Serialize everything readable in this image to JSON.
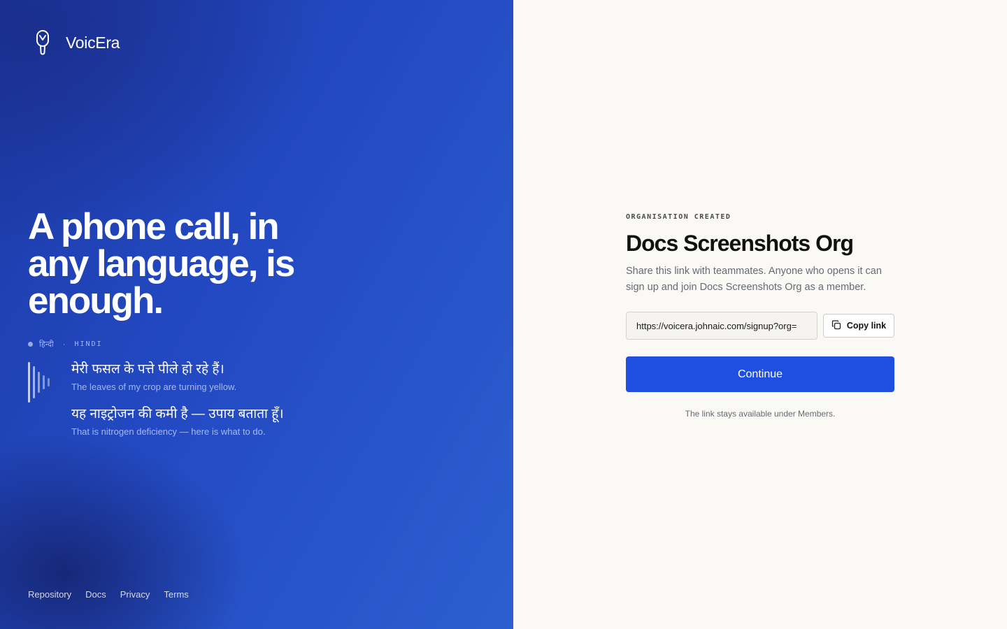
{
  "brand": {
    "name": "VoicEra"
  },
  "hero": {
    "headline": "A phone call, in any language, is enough.",
    "language_native": "हिन्दी",
    "language_separator": "·",
    "language_code": "HINDI",
    "transcript": [
      {
        "hindi": "मेरी फसल के पत्ते पीले हो रहे हैं।",
        "english": "The leaves of my crop are turning yellow."
      },
      {
        "hindi": "यह नाइट्रोजन की कमी है — उपाय बताता हूँ।",
        "english": "That is nitrogen deficiency — here is what to do."
      }
    ]
  },
  "footer": {
    "links": [
      "Repository",
      "Docs",
      "Privacy",
      "Terms"
    ]
  },
  "panel": {
    "eyebrow": "ORGANISATION CREATED",
    "title": "Docs Screenshots Org",
    "description": "Share this link with teammates. Anyone who opens it can sign up and join Docs Screenshots Org as a member.",
    "invite_link": "https://voicera.johnaic.com/signup?org=",
    "copy_label": "Copy link",
    "continue_label": "Continue",
    "note": "The link stays available under Members."
  },
  "colors": {
    "accent": "#1f4fe0",
    "hero_bg": "#2349c2",
    "page_bg": "#faf9f6"
  },
  "icons": {
    "logo": "microphone-icon",
    "copy": "copy-icon",
    "waveform": "waveform-icon"
  }
}
